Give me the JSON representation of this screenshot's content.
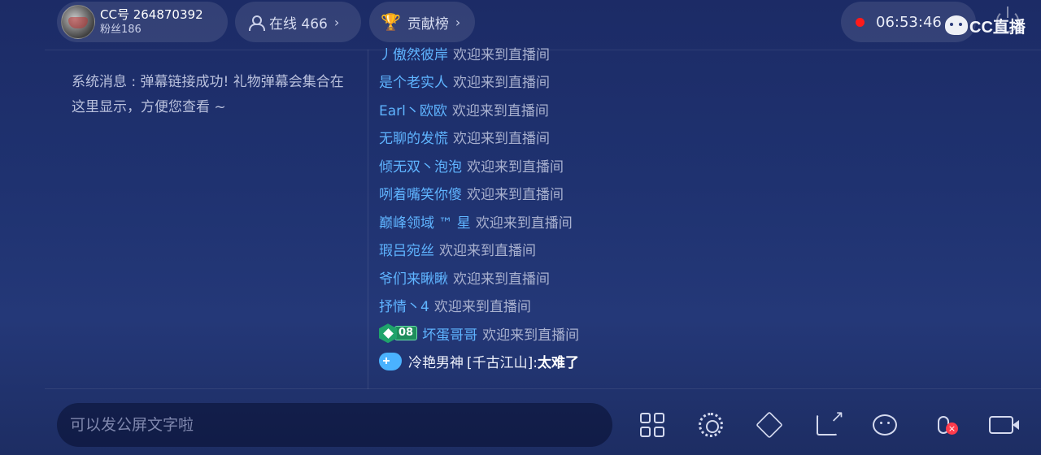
{
  "header": {
    "anchor_id": "CC号 264870392",
    "fans": "粉丝186",
    "online": "在线 466",
    "contribution": "贡献榜",
    "chevron": "›",
    "record_time": "06:53:46",
    "brand": "CC直播",
    "colors": {
      "record_dot": "#ff1a1a",
      "username": "#5fb4ff",
      "badge": "#1fa36b"
    }
  },
  "system_message": "系统消息 : 弹幕链接成功! 礼物弹幕会集合在这里显示，方便您查看 ~",
  "chat": {
    "welcome_text": "欢迎来到直播间",
    "rows": [
      {
        "user": "丿傲然彼岸"
      },
      {
        "user": "是个老实人"
      },
      {
        "user": "Earl丶欧欧"
      },
      {
        "user": "无聊的发慌"
      },
      {
        "user": "倾无双丶泡泡"
      },
      {
        "user": "咧着嘴笑你傻"
      },
      {
        "user": "巅峰领域 ™ 星"
      },
      {
        "user": "瑕吕宛丝"
      },
      {
        "user": "爷们来瞅瞅"
      },
      {
        "user": "抒情丶4"
      }
    ],
    "badge_row": {
      "badge_level": "08",
      "user": "坏蛋哥哥"
    },
    "message": {
      "user": "冷艳男神",
      "tag": "[千古江山]:",
      "text": "太难了"
    }
  },
  "input": {
    "placeholder": "可以发公屏文字啦"
  },
  "toolbar": {
    "icons": [
      "apps-icon",
      "settings-icon",
      "gift-box-icon",
      "share-icon",
      "emoji-add-icon",
      "mic-off-icon",
      "camera-icon"
    ],
    "mic_badge": "×"
  }
}
